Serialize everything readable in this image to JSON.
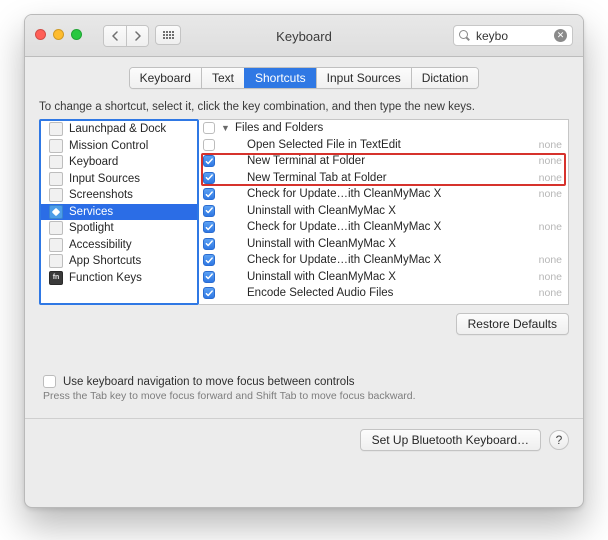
{
  "window": {
    "title": "Keyboard",
    "search_value": "keybo"
  },
  "tabs": [
    "Keyboard",
    "Text",
    "Shortcuts",
    "Input Sources",
    "Dictation"
  ],
  "active_tab_index": 2,
  "instruction": "To change a shortcut, select it, click the key combination, and then type the new keys.",
  "categories": [
    {
      "label": "Launchpad & Dock",
      "icon": "launchpad"
    },
    {
      "label": "Mission Control",
      "icon": "mission"
    },
    {
      "label": "Keyboard",
      "icon": "keyboard"
    },
    {
      "label": "Input Sources",
      "icon": "input"
    },
    {
      "label": "Screenshots",
      "icon": "screenshots"
    },
    {
      "label": "Services",
      "icon": "services",
      "selected": true
    },
    {
      "label": "Spotlight",
      "icon": "spotlight"
    },
    {
      "label": "Accessibility",
      "icon": "accessibility"
    },
    {
      "label": "App Shortcuts",
      "icon": "app"
    },
    {
      "label": "Function Keys",
      "icon": "fn"
    }
  ],
  "services": {
    "group_label": "Files and Folders",
    "items": [
      {
        "checked": false,
        "label": "Open Selected File in TextEdit",
        "note": "none"
      },
      {
        "checked": true,
        "label": "New Terminal at Folder",
        "note": "none",
        "highlight": true
      },
      {
        "checked": true,
        "label": "New Terminal Tab at Folder",
        "note": "none",
        "highlight": true
      },
      {
        "checked": true,
        "label": "Check for Update…ith CleanMyMac X",
        "note": "none"
      },
      {
        "checked": true,
        "label": "Uninstall with CleanMyMac X",
        "note": ""
      },
      {
        "checked": true,
        "label": "Check for Update…ith CleanMyMac X",
        "note": "none"
      },
      {
        "checked": true,
        "label": "Uninstall with CleanMyMac X",
        "note": ""
      },
      {
        "checked": true,
        "label": "Check for Update…ith CleanMyMac X",
        "note": "none"
      },
      {
        "checked": true,
        "label": "Uninstall with CleanMyMac X",
        "note": "none"
      },
      {
        "checked": true,
        "label": "Encode Selected Audio Files",
        "note": "none"
      }
    ]
  },
  "restore_label": "Restore Defaults",
  "kb_nav_label": "Use keyboard navigation to move focus between controls",
  "kb_nav_hint": "Press the Tab key to move focus forward and Shift Tab to move focus backward.",
  "bluetooth_label": "Set Up Bluetooth Keyboard…",
  "help_label": "?"
}
